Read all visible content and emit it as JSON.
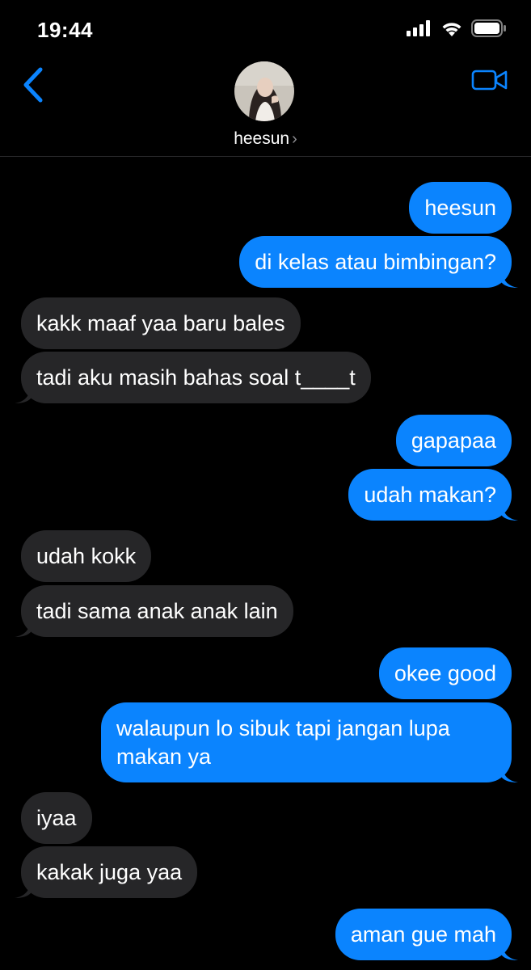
{
  "status_bar": {
    "time": "19:44"
  },
  "header": {
    "contact_name": "heesun",
    "chevron": "›"
  },
  "colors": {
    "sent_bubble": "#0b84fe",
    "received_bubble": "#262628",
    "accent": "#0b84fe",
    "background": "#000000"
  },
  "messages": [
    {
      "direction": "sent",
      "text": "heesun"
    },
    {
      "direction": "sent",
      "text": "di kelas atau bimbingan?"
    },
    {
      "direction": "received",
      "text": "kakk maaf yaa baru bales"
    },
    {
      "direction": "received",
      "text": "tadi aku masih bahas soal t____t"
    },
    {
      "direction": "sent",
      "text": "gapapaa"
    },
    {
      "direction": "sent",
      "text": "udah makan?"
    },
    {
      "direction": "received",
      "text": "udah kokk"
    },
    {
      "direction": "received",
      "text": "tadi sama anak anak lain"
    },
    {
      "direction": "sent",
      "text": "okee good"
    },
    {
      "direction": "sent",
      "text": "walaupun lo sibuk tapi jangan lupa makan ya"
    },
    {
      "direction": "received",
      "text": "iyaa"
    },
    {
      "direction": "received",
      "text": "kakak juga yaa"
    },
    {
      "direction": "sent",
      "text": "aman gue mah"
    }
  ],
  "icons": {
    "back": "chevron-left-icon",
    "video": "video-camera-icon",
    "signal": "cellular-signal-icon",
    "wifi": "wifi-icon",
    "battery": "battery-icon"
  }
}
